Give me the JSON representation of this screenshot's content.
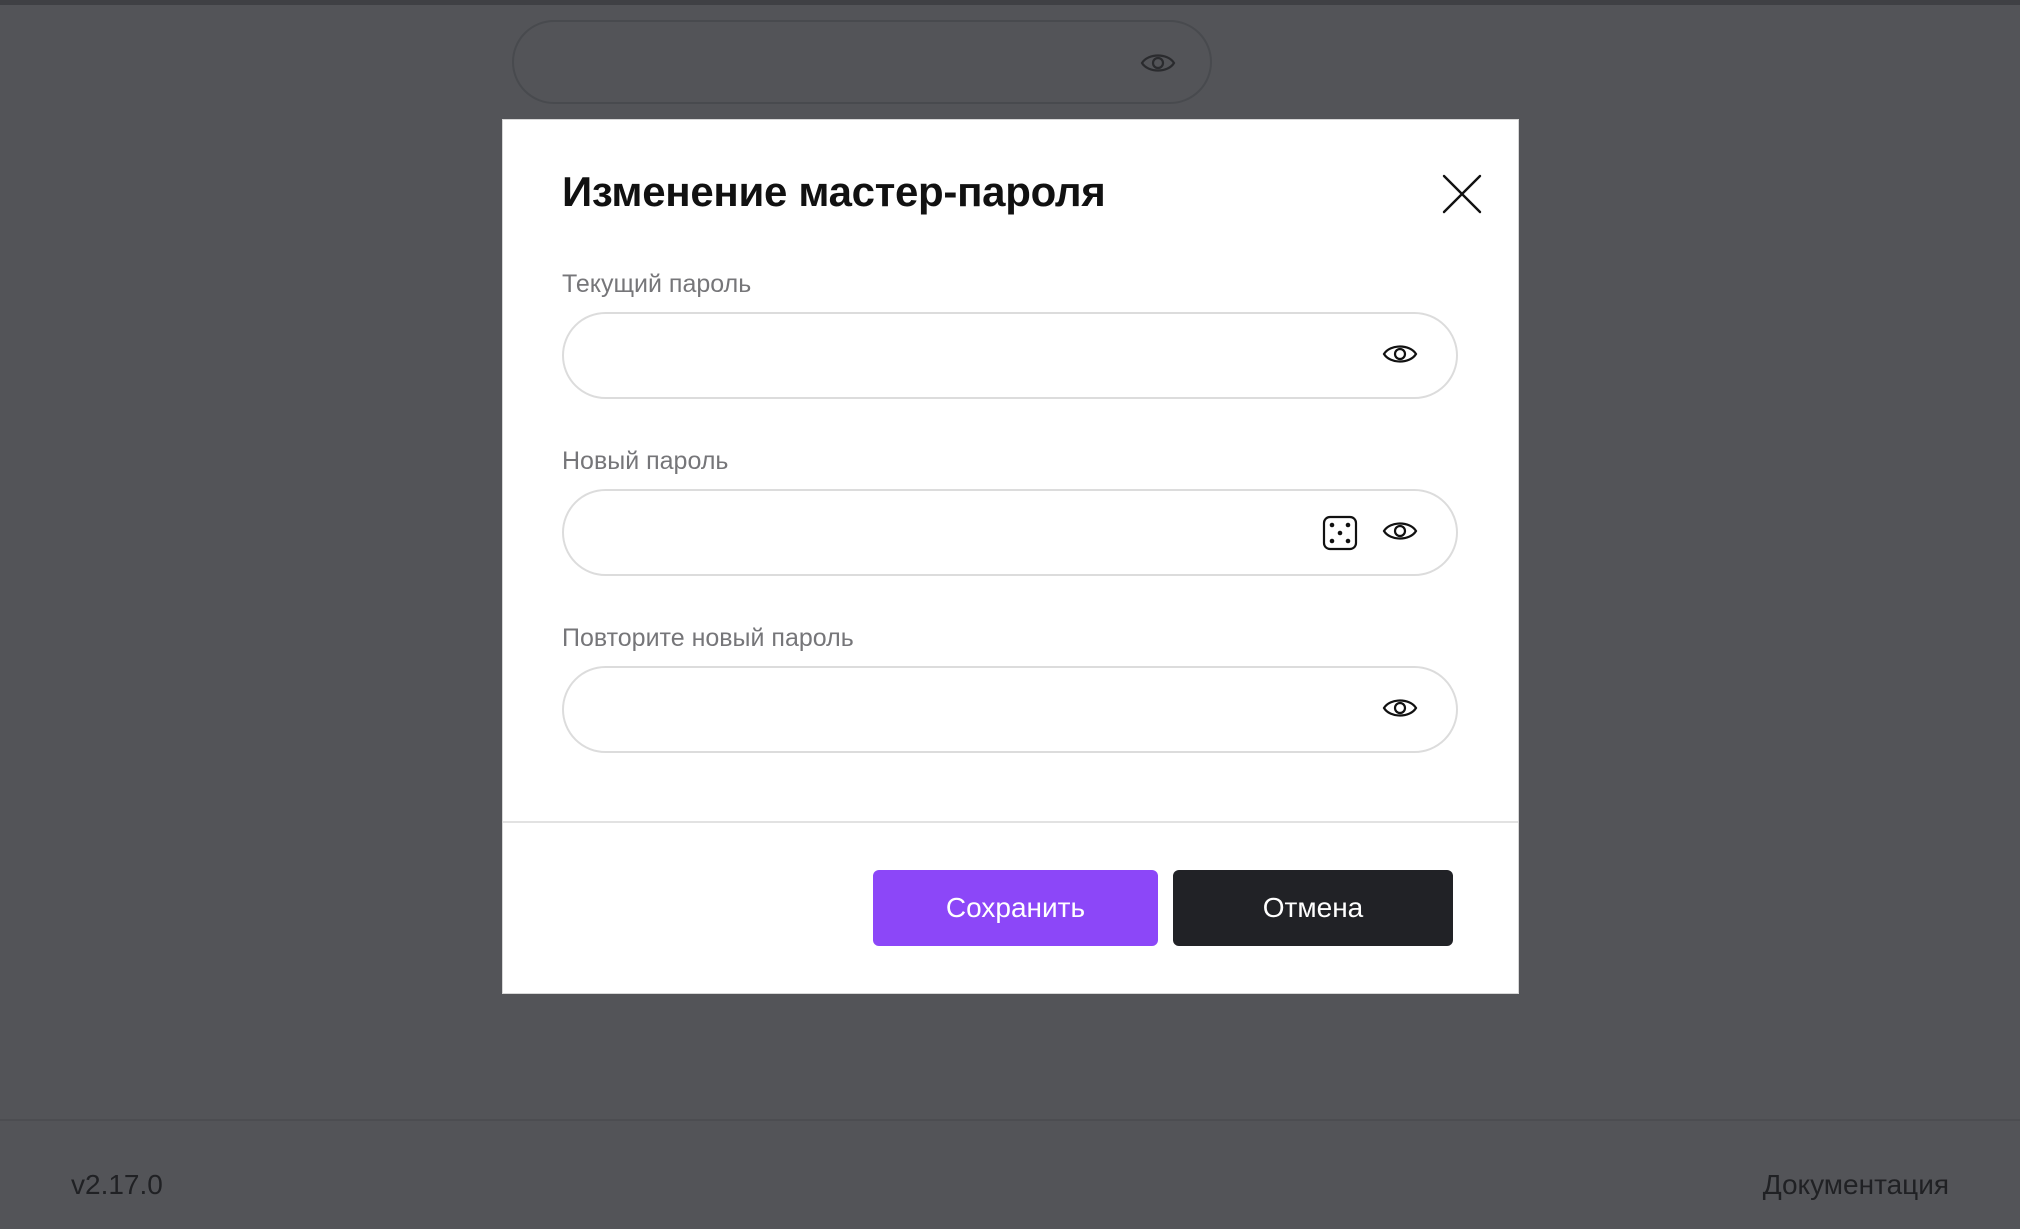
{
  "modal": {
    "title": "Изменение мастер-пароля",
    "fields": [
      {
        "label": "Текущий пароль",
        "value": "",
        "placeholder": ""
      },
      {
        "label": "Новый пароль",
        "value": "",
        "placeholder": ""
      },
      {
        "label": "Повторите новый пароль",
        "value": "",
        "placeholder": ""
      }
    ],
    "save_label": "Сохранить",
    "cancel_label": "Отмена"
  },
  "footer": {
    "version": "v2.17.0",
    "docs_link": "Документация"
  },
  "icons": {
    "close": "close-icon",
    "eye": "eye-icon",
    "dice": "dice-icon"
  },
  "colors": {
    "accent": "#8c47f8",
    "dark_button": "#212226",
    "overlay": "#535458"
  }
}
